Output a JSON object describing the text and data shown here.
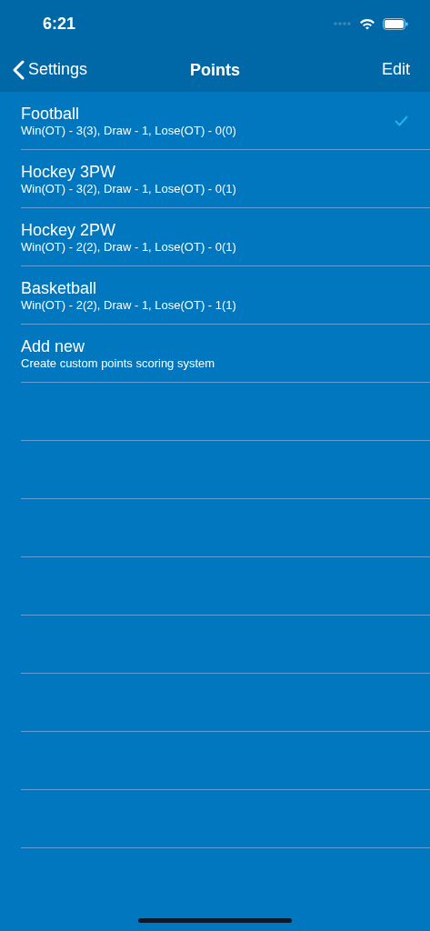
{
  "status_bar": {
    "time": "6:21"
  },
  "nav": {
    "back": "Settings",
    "title": "Points",
    "action": "Edit"
  },
  "rows": [
    {
      "kind": "option",
      "title": "Football",
      "subtitle": "Win(OT) - 3(3), Draw - 1, Lose(OT) - 0(0)",
      "selected": true
    },
    {
      "kind": "option",
      "title": "Hockey 3PW",
      "subtitle": "Win(OT) - 3(2), Draw - 1, Lose(OT) - 0(1)",
      "selected": false
    },
    {
      "kind": "option",
      "title": "Hockey 2PW",
      "subtitle": "Win(OT) - 2(2), Draw - 1, Lose(OT) - 0(1)",
      "selected": false
    },
    {
      "kind": "option",
      "title": "Basketball",
      "subtitle": "Win(OT) - 2(2), Draw - 1, Lose(OT) - 1(1)",
      "selected": false
    },
    {
      "kind": "action",
      "title": "Add new",
      "subtitle": "Create custom points scoring system"
    }
  ]
}
